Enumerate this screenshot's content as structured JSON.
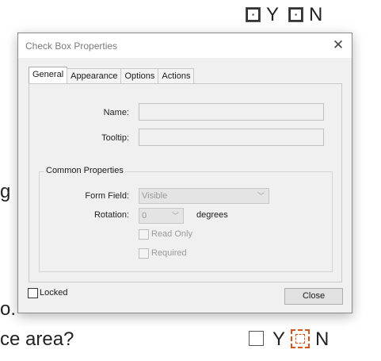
{
  "background": {
    "top_row": {
      "yes_label": "Y",
      "no_label": "N"
    },
    "left_fragments": [
      "g",
      "o."
    ],
    "question": "ce area?",
    "bottom_row": {
      "yes_label": "Y",
      "no_label": "N"
    },
    "highlight_color": "#d9531e"
  },
  "dialog": {
    "title": "Check Box Properties",
    "tabs": [
      {
        "label": "General",
        "active": true
      },
      {
        "label": "Appearance",
        "active": false
      },
      {
        "label": "Options",
        "active": false
      },
      {
        "label": "Actions",
        "active": false
      }
    ],
    "general": {
      "name_label": "Name:",
      "name_value": "",
      "tooltip_label": "Tooltip:",
      "tooltip_value": "",
      "common_properties_title": "Common Properties",
      "form_field_label": "Form Field:",
      "form_field_value": "Visible",
      "rotation_label": "Rotation:",
      "rotation_value": "0",
      "rotation_unit": "degrees",
      "read_only_label": "Read Only",
      "read_only_checked": false,
      "required_label": "Required",
      "required_checked": false
    },
    "locked_label": "Locked",
    "locked_checked": false,
    "close_label": "Close"
  }
}
